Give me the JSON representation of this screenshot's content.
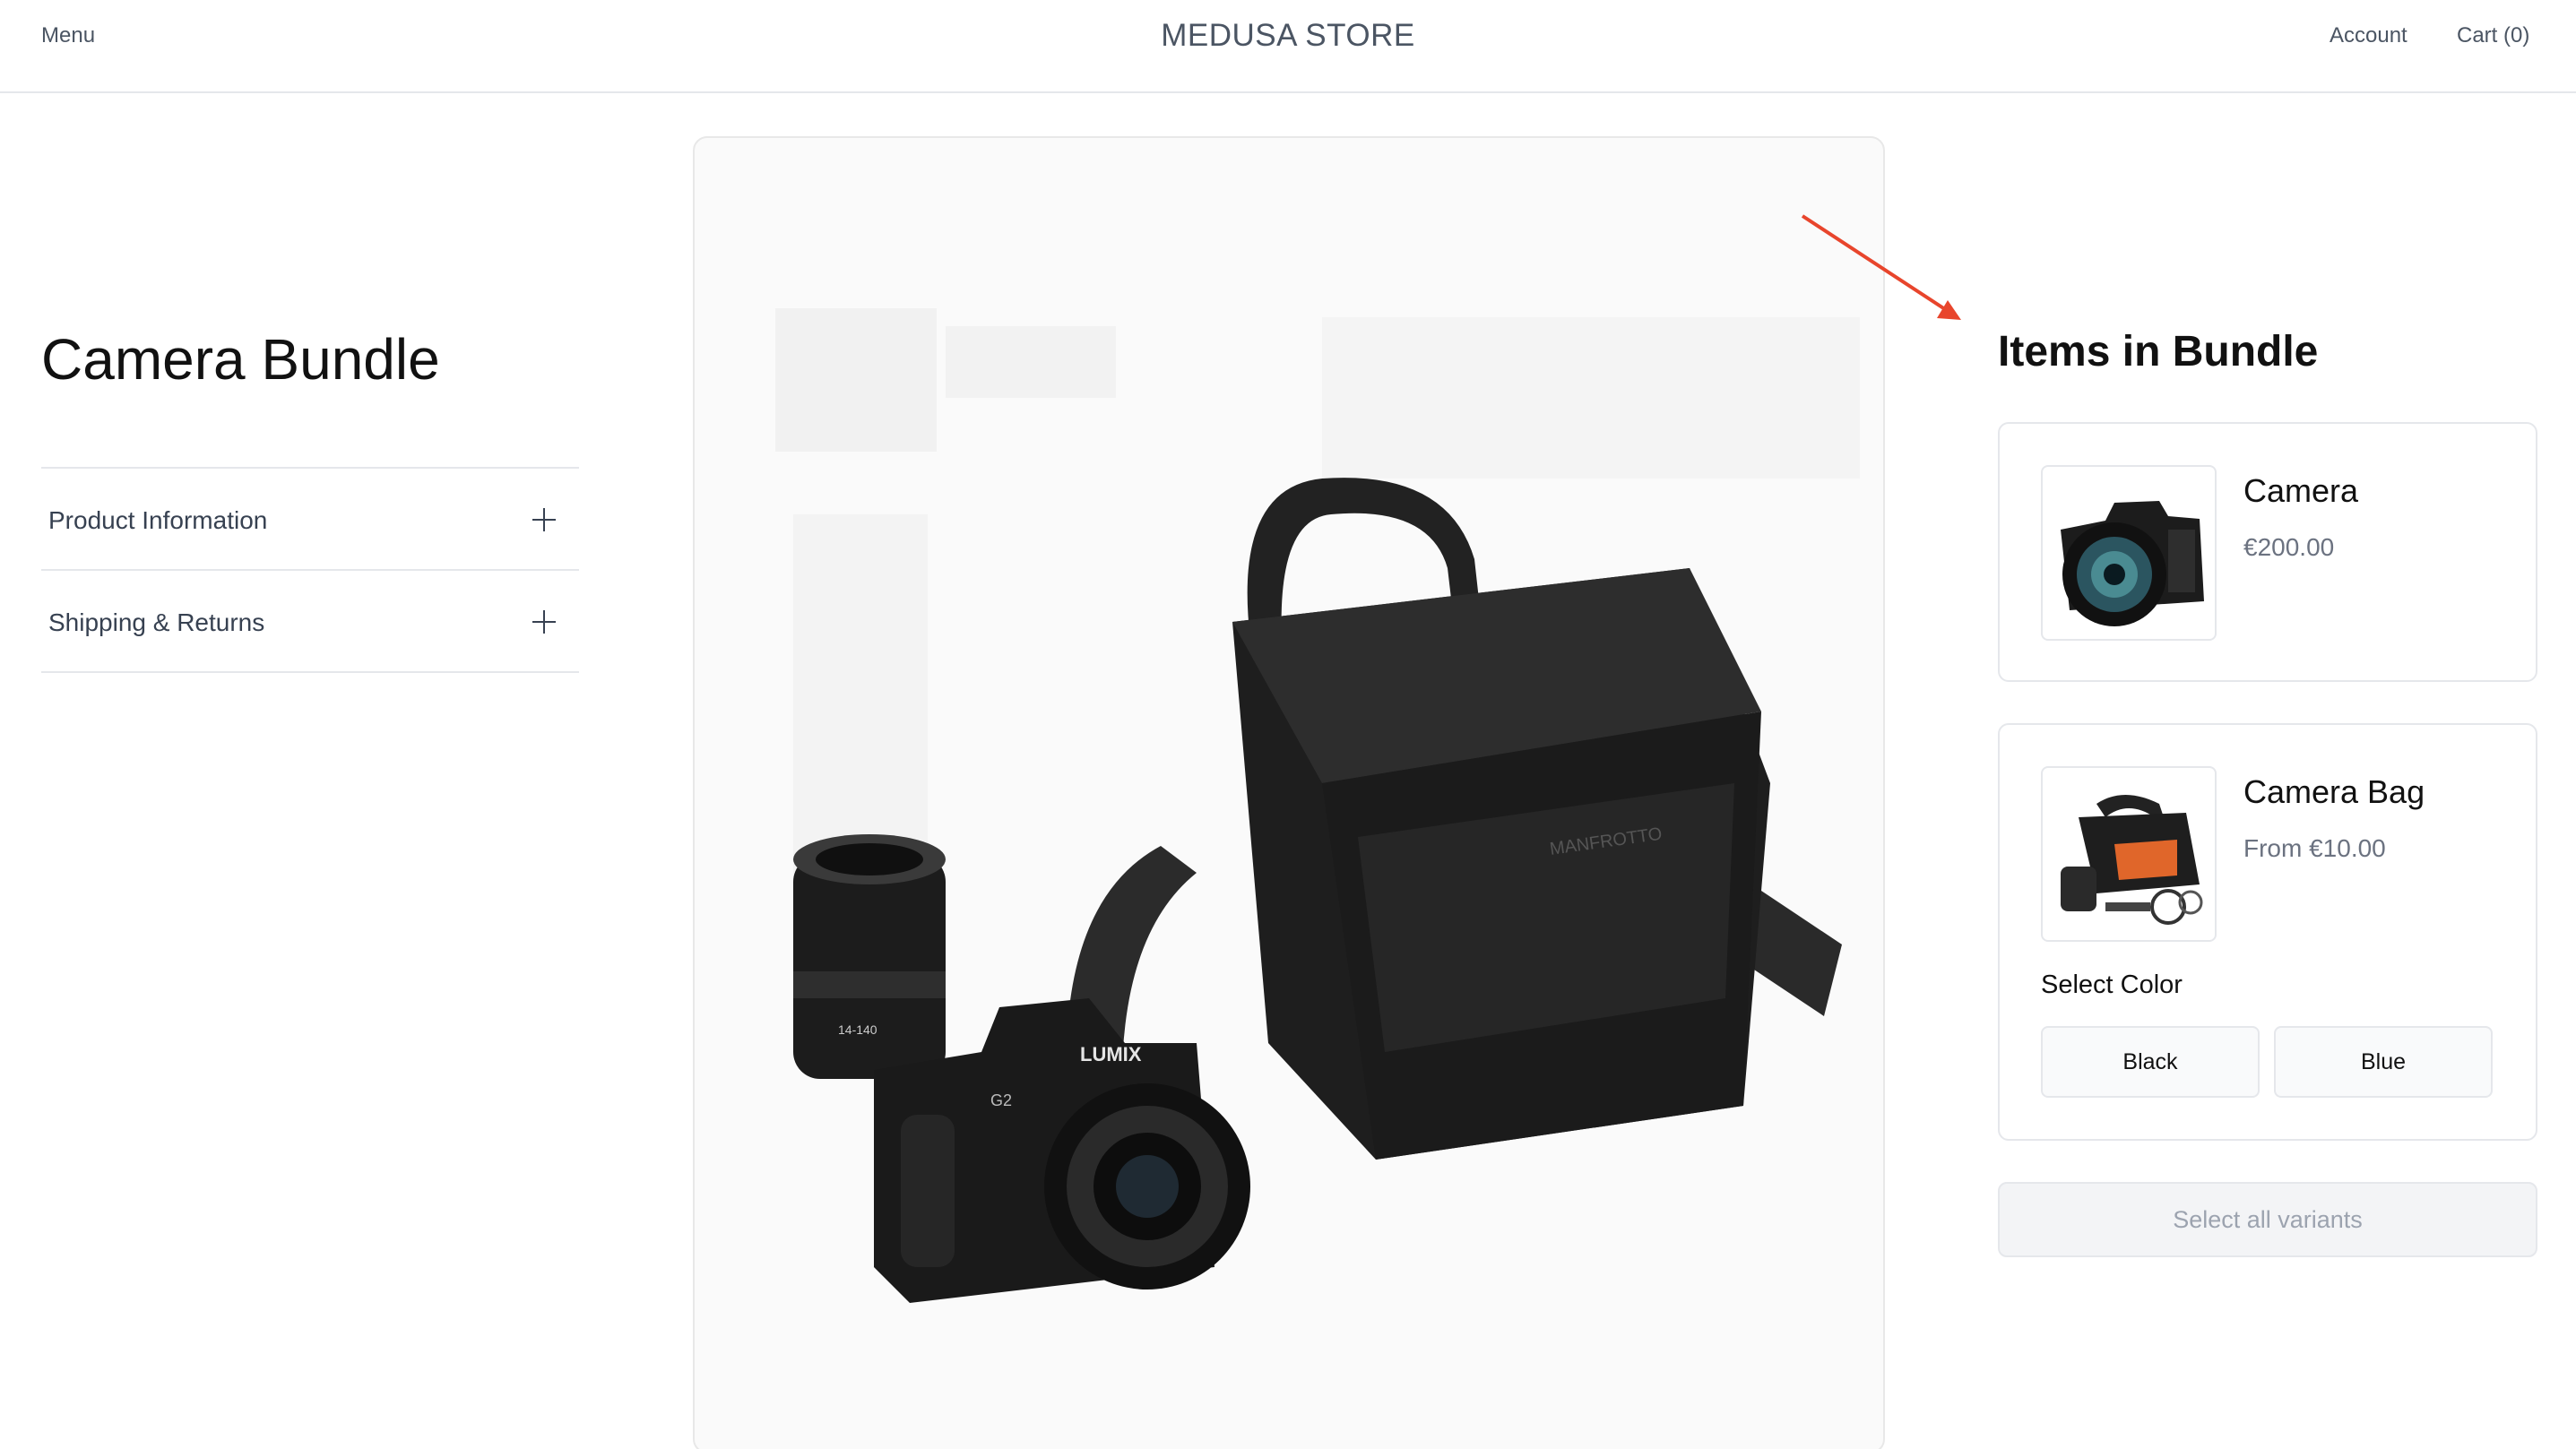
{
  "header": {
    "menu_label": "Menu",
    "store_title": "MEDUSA STORE",
    "account_label": "Account",
    "cart_label": "Cart (0)"
  },
  "product": {
    "title": "Camera Bundle",
    "accordion": [
      {
        "label": "Product Information"
      },
      {
        "label": "Shipping & Returns"
      }
    ]
  },
  "bundle": {
    "title": "Items in Bundle",
    "items": [
      {
        "name": "Camera",
        "price": "€200.00"
      },
      {
        "name": "Camera Bag",
        "price": "From €10.00",
        "select_label": "Select Color",
        "options": [
          "Black",
          "Blue"
        ]
      }
    ],
    "select_all_label": "Select all variants"
  },
  "colors": {
    "arrow": "#e8452c",
    "border": "#e5e7eb",
    "muted_text": "#6b7280"
  },
  "icons": [
    "plus-icon",
    "annotation-arrow-icon"
  ]
}
